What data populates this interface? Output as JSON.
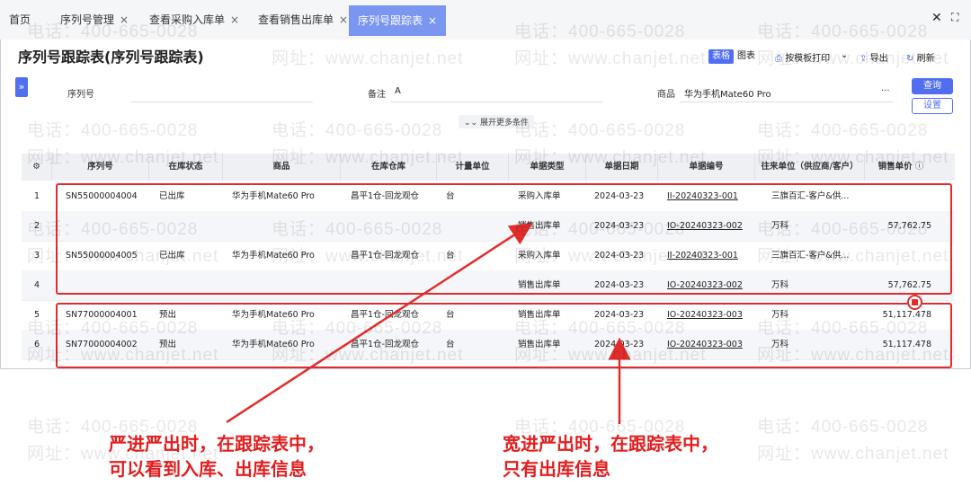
{
  "tabs": [
    {
      "label": "首页",
      "closable": false
    },
    {
      "label": "序列号管理",
      "closable": true
    },
    {
      "label": "查看采购入库单",
      "closable": true
    },
    {
      "label": "查看销售出库单",
      "closable": true
    },
    {
      "label": "序列号跟踪表",
      "closable": true,
      "active": true
    }
  ],
  "close_glyph": "×",
  "page_title": "序列号跟踪表(序列号跟踪表)",
  "toolbar": {
    "view_table": "表格",
    "view_chart": "图表",
    "print_label": "按模板打印",
    "export_label": "导出",
    "refresh_label": "刷新"
  },
  "filters": {
    "serial_label": "序列号",
    "serial_value": "",
    "remark_label": "备注",
    "remark_value": "A",
    "product_label": "商品",
    "product_value": "华为手机Mate60 Pro",
    "more_glyph": "···",
    "search_button": "查询",
    "settings_button": "设置",
    "expand_more": "展开更多条件"
  },
  "table": {
    "columns": [
      "序列号",
      "在库状态",
      "商品",
      "在库仓库",
      "计量单位",
      "单据类型",
      "单据日期",
      "单据编号",
      "往来单位（供应商/客户）",
      "销售单价"
    ],
    "rows": [
      {
        "no": "1",
        "serial": "SN55000004004",
        "status": "已出库",
        "product": "华为手机Mate60 Pro",
        "warehouse": "昌平1仓-回龙观仓",
        "unit": "台",
        "doc_type": "采购入库单",
        "doc_date": "2024-03-23",
        "doc_no": "II-20240323-001",
        "partner": "三旗百汇-客户&供...",
        "price": ""
      },
      {
        "no": "2",
        "serial": "",
        "status": "",
        "product": "",
        "warehouse": "",
        "unit": "",
        "doc_type": "销售出库单",
        "doc_date": "2024-03-23",
        "doc_no": "IO-20240323-002",
        "partner": "万科",
        "price": "57,762.75"
      },
      {
        "no": "3",
        "serial": "SN55000004005",
        "status": "已出库",
        "product": "华为手机Mate60 Pro",
        "warehouse": "昌平1仓-回龙观仓",
        "unit": "台",
        "doc_type": "采购入库单",
        "doc_date": "2024-03-23",
        "doc_no": "II-20240323-001",
        "partner": "三旗百汇-客户&供...",
        "price": ""
      },
      {
        "no": "4",
        "serial": "",
        "status": "",
        "product": "",
        "warehouse": "",
        "unit": "",
        "doc_type": "销售出库单",
        "doc_date": "2024-03-23",
        "doc_no": "IO-20240323-002",
        "partner": "万科",
        "price": "57,762.75"
      },
      {
        "no": "5",
        "serial": "SN77000004001",
        "status": "预出",
        "product": "华为手机Mate60 Pro",
        "warehouse": "昌平1仓-回龙观仓",
        "unit": "台",
        "doc_type": "销售出库单",
        "doc_date": "2024-03-23",
        "doc_no": "IO-20240323-003",
        "partner": "万科",
        "price": "51,117.478"
      },
      {
        "no": "6",
        "serial": "SN77000004002",
        "status": "预出",
        "product": "华为手机Mate60 Pro",
        "warehouse": "昌平1仓-回龙观仓",
        "unit": "台",
        "doc_type": "销售出库单",
        "doc_date": "2024-03-23",
        "doc_no": "IO-20240323-003",
        "partner": "万科",
        "price": "51,117.478"
      }
    ]
  },
  "annotations": {
    "left_line1": "严进严出时，在跟踪表中，",
    "left_line2": "可以看到入库、出库信息",
    "right_line1": "宽进严出时，在跟踪表中，",
    "right_line2": "只有出库信息"
  },
  "watermark": {
    "phone": "电话：400-665-0028",
    "site": "网址：www.chanjet.net"
  },
  "colors": {
    "accent": "#4f6ff0",
    "active_tab": "#7b96f0",
    "annotation_red": "#e21e1e"
  },
  "icons": [
    "close-icon",
    "fullscreen-icon",
    "print-icon",
    "chevron-down-icon",
    "export-icon",
    "refresh-icon",
    "expand-panel-icon",
    "double-chevron-down-icon",
    "column-settings-icon",
    "help-icon"
  ]
}
